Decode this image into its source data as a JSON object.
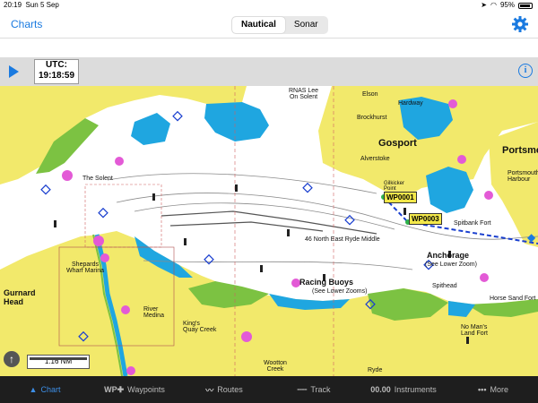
{
  "status": {
    "time": "20:19",
    "date": "Sun 5 Sep",
    "battery": "95%"
  },
  "nav": {
    "back_label": "Charts",
    "segments": [
      "Nautical",
      "Sonar"
    ],
    "selected_segment": "Nautical"
  },
  "toolbar": {
    "utc_label": "UTC:",
    "utc_time": "19:18:59",
    "info_symbol": "i"
  },
  "map": {
    "labels": {
      "rnas": "RNAS Lee\nOn Solent",
      "elson": "Elson",
      "hardway": "Hardway",
      "brockhurst": "Brockhurst",
      "gosport": "Gosport",
      "portsmouth": "Portsmou",
      "alverstoke": "Alverstoke",
      "portsmouth_harbour": "Portsmouth\nHarbour",
      "gilkicker": "Gilkicker\nPoint",
      "the_solent": "The Solent",
      "spitbank": "Spitbank Fort",
      "ryde_middle": "46 North East Ryde Middle",
      "anchorage": "Anchorage",
      "anchorage_sub": "(See Lower Zoom)",
      "spithead": "Spithead",
      "horse_sand": "Horse Sand Fort",
      "shepards": "Shepards\nWharf Marina",
      "racing_buoys": "Racing Buoys",
      "racing_sub": "(See Lower Zooms)",
      "gurnard_head": "Gurnard\nHead",
      "river_medina": "River\nMedina",
      "kings_quay": "King's\nQuay Creek",
      "no_mans": "No Man's\nLand Fort",
      "wootton": "Wootton\nCreek",
      "ryde": "Ryde"
    },
    "waypoints": [
      "WP0001",
      "WP0003"
    ],
    "scale_label": "1.16 NM"
  },
  "tabs": [
    {
      "label": "Chart",
      "icon": "chart-icon",
      "glyph": "▲",
      "active": true
    },
    {
      "label": "Waypoints",
      "icon": "waypoint-icon",
      "glyph": "WP✚",
      "active": false
    },
    {
      "label": "Routes",
      "icon": "routes-icon",
      "glyph": "〰",
      "active": false
    },
    {
      "label": "Track",
      "icon": "track-icon",
      "glyph": "╌╌",
      "active": false
    },
    {
      "label": "Instruments",
      "icon": "instruments-icon",
      "glyph": "00.00",
      "active": false
    },
    {
      "label": "More",
      "icon": "more-icon",
      "glyph": "•••",
      "active": false
    }
  ],
  "colors": {
    "accent": "#1a7ae0",
    "land": "#f2e96b",
    "shallow": "#1fa6e0",
    "intertidal": "#7cc242",
    "tabbar": "#1e1e1e"
  }
}
